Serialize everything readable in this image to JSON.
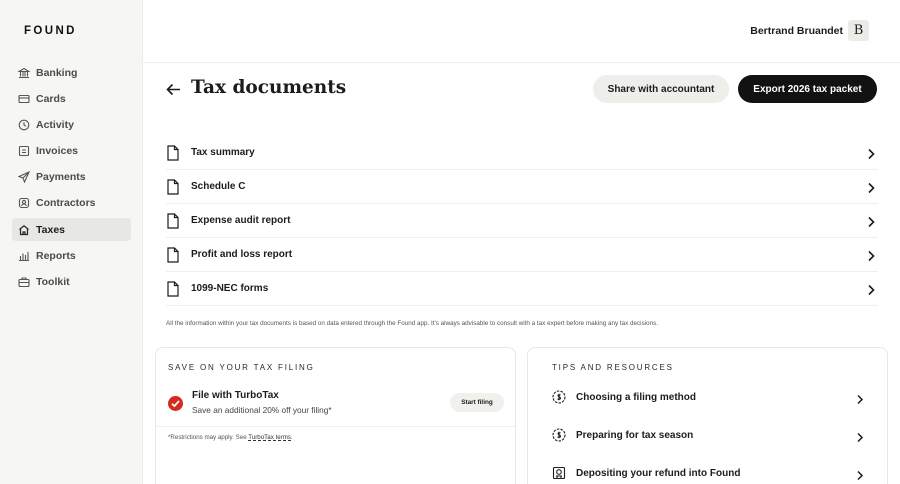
{
  "app": {
    "logo": "FOUND"
  },
  "sidebar": {
    "items": [
      {
        "label": "Banking",
        "icon": "bank-icon"
      },
      {
        "label": "Cards",
        "icon": "card-icon"
      },
      {
        "label": "Activity",
        "icon": "clock-icon"
      },
      {
        "label": "Invoices",
        "icon": "invoice-icon"
      },
      {
        "label": "Payments",
        "icon": "send-icon"
      },
      {
        "label": "Contractors",
        "icon": "contractors-icon"
      },
      {
        "label": "Taxes",
        "icon": "taxes-icon",
        "active": true
      },
      {
        "label": "Reports",
        "icon": "bar-chart-icon"
      },
      {
        "label": "Toolkit",
        "icon": "toolkit-icon"
      }
    ]
  },
  "header": {
    "user_name": "Bertrand Bruandet",
    "avatar_letter": "B"
  },
  "page": {
    "title": "Tax documents",
    "share_button": "Share with accountant",
    "export_button": "Export 2026 tax packet"
  },
  "documents": [
    {
      "label": "Tax summary"
    },
    {
      "label": "Schedule C"
    },
    {
      "label": "Expense audit report"
    },
    {
      "label": "Profit and loss report"
    },
    {
      "label": "1099-NEC forms"
    }
  ],
  "disclaimer": "All the information within your tax documents is based on data entered through the Found app. It’s always advisable to consult with a tax expert before making any tax decisions.",
  "save_card": {
    "eyebrow": "SAVE ON YOUR TAX FILING",
    "title": "File with TurboTax",
    "description": "Save an additional 20% off your filing*",
    "button": "Start filing",
    "restriction_prefix": "*Restrictions may apply. See ",
    "restriction_link": "TurboTax terms",
    "restriction_suffix": "."
  },
  "tips_card": {
    "eyebrow": "TIPS AND RESOURCES",
    "items": [
      {
        "label": "Choosing a filing method",
        "icon": "clock-dollar-icon"
      },
      {
        "label": "Preparing for tax season",
        "icon": "clock-dollar-icon"
      },
      {
        "label": "Depositing your refund into Found",
        "icon": "bank-deposit-icon"
      }
    ]
  },
  "colors": {
    "primary_button": "#121212",
    "secondary_button": "#eeeeeb",
    "sidebar_bg": "#f6f6f4",
    "turbotax_red": "#d52b1e"
  }
}
